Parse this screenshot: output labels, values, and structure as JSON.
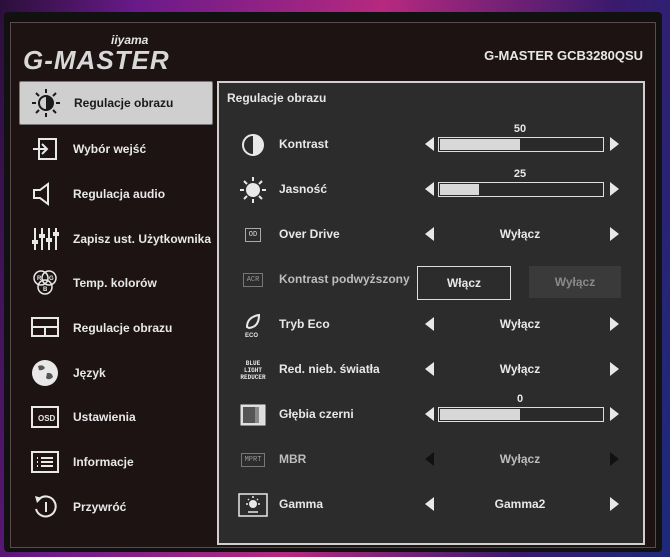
{
  "header": {
    "brand": "iiyama",
    "logo": "G-MASTER",
    "model": "G-MASTER GCB3280QSU"
  },
  "sidebar": {
    "items": [
      {
        "label": "Regulacje obrazu",
        "icon": "sun-icon",
        "active": true
      },
      {
        "label": "Wybór wejść",
        "icon": "input-icon"
      },
      {
        "label": "Regulacja audio",
        "icon": "speaker-icon"
      },
      {
        "label": "Zapisz ust. Użytkownika",
        "icon": "sliders-icon"
      },
      {
        "label": "Temp. kolorów",
        "icon": "rgb-icon"
      },
      {
        "label": "Regulacje obrazu",
        "icon": "picture-icon"
      },
      {
        "label": "Język",
        "icon": "globe-icon"
      },
      {
        "label": "Ustawienia",
        "icon": "osd-icon"
      },
      {
        "label": "Informacje",
        "icon": "info-icon"
      },
      {
        "label": "Przywróć",
        "icon": "reset-icon"
      }
    ]
  },
  "panel": {
    "title": "Regulacje obrazu",
    "rows": {
      "contrast": {
        "label": "Kontrast",
        "value": "50",
        "level": 50
      },
      "brightness": {
        "label": "Jasność",
        "value": "25",
        "level": 25
      },
      "overdrive": {
        "label": "Over Drive",
        "value": "Wyłącz",
        "icon_text": "OD"
      },
      "acr": {
        "label": "Kontrast podwyższony",
        "on": "Włącz",
        "off": "Wyłącz",
        "icon_text": "ACR"
      },
      "eco": {
        "label": "Tryb Eco",
        "value": "Wyłącz",
        "icon_text": "ECO"
      },
      "bluelight": {
        "label": "Red. nieb. światła",
        "value": "Wyłącz",
        "icon_text": "BLUE LIGHT REDUCER"
      },
      "blacklevel": {
        "label": "Głębia czerni",
        "value": "0",
        "level": 50
      },
      "mbr": {
        "label": "MBR",
        "value": "Wyłącz",
        "icon_text": "MPRT"
      },
      "gamma": {
        "label": "Gamma",
        "value": "Gamma2"
      }
    }
  },
  "colors": {
    "active_bg": "#cfcfcf",
    "panel_bg": "#2c2c2c",
    "osd_bg": "#1d1313"
  }
}
